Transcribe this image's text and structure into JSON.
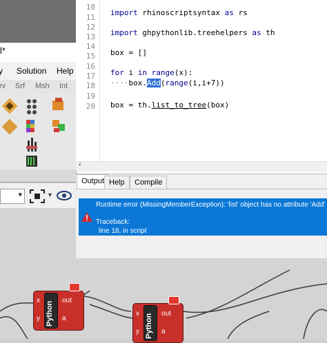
{
  "grasshopper": {
    "title_fragment": "l*",
    "menu": [
      "y",
      "Solution",
      "Help"
    ],
    "tabs": [
      "rv",
      "Srf",
      "Msh",
      "Int"
    ]
  },
  "editor": {
    "lines": [
      {
        "num": "10",
        "code": ""
      },
      {
        "num": "11",
        "code": "import rhinoscriptsyntax as rs"
      },
      {
        "num": "12",
        "code": ""
      },
      {
        "num": "13",
        "code": "import ghpythonlib.treehelpers as th"
      },
      {
        "num": "14",
        "code": ""
      },
      {
        "num": "15",
        "code": "box = []"
      },
      {
        "num": "16",
        "code": ""
      },
      {
        "num": "17",
        "code": "for i in range(x):"
      },
      {
        "num": "18",
        "code": "····box.Add(range(i,i+7))"
      },
      {
        "num": "19",
        "code": ""
      },
      {
        "num": "20",
        "code": "box = th.list_to_tree(box)"
      }
    ],
    "selected_token": "Add"
  },
  "output": {
    "tabs": [
      "Output",
      "Help",
      "Compile"
    ],
    "active_tab": "Output",
    "error": "Runtime error (MissingMemberException): 'list' object has no attribute 'Add'",
    "traceback_label": "Traceback:",
    "traceback_line": "line 18, in script"
  },
  "components": [
    {
      "name": "Python",
      "inputs": [
        "x",
        "y"
      ],
      "outputs": [
        "out",
        "a"
      ]
    },
    {
      "name": "Python",
      "inputs": [
        "x",
        "y"
      ],
      "outputs": [
        "out",
        "a"
      ]
    }
  ],
  "colors": {
    "error_bg": "#0b78d7",
    "selection": "#2f6fd6",
    "component": "#c9302a"
  }
}
